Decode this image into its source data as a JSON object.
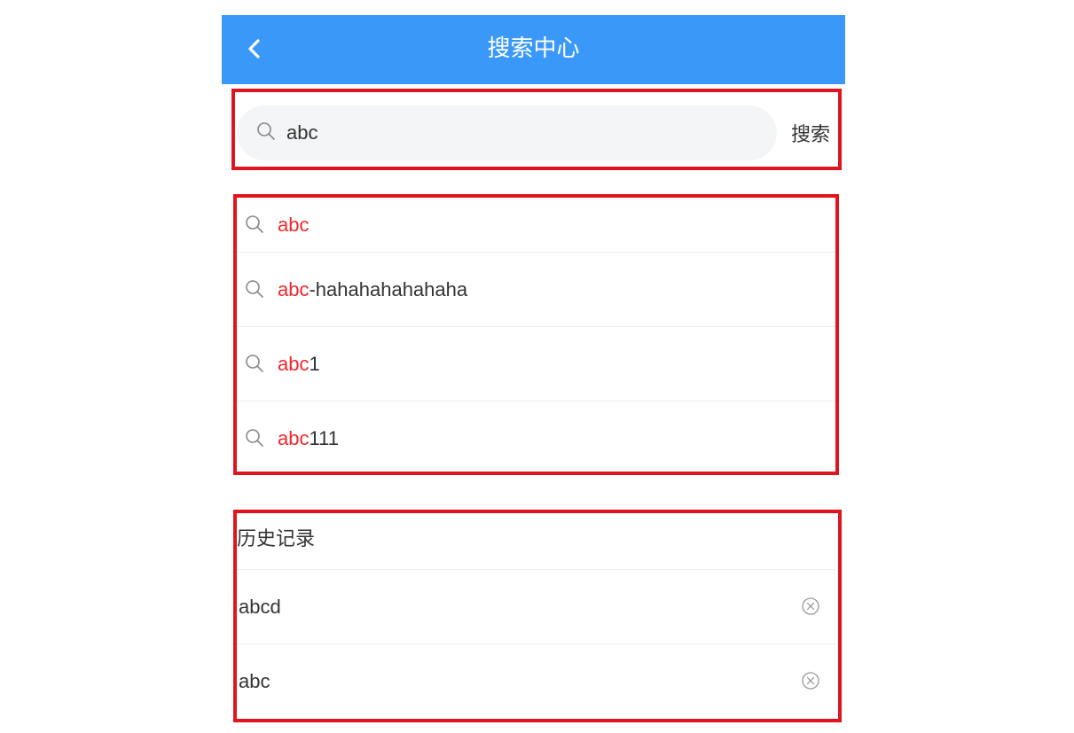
{
  "header": {
    "title": "搜索中心",
    "back_icon": "chevron-left-icon",
    "background": "#3a99f8"
  },
  "search": {
    "value": "abc",
    "placeholder": "",
    "button_label": "搜索",
    "icon": "search-icon"
  },
  "suggestions": [
    {
      "highlight": "abc",
      "rest": ""
    },
    {
      "highlight": "abc",
      "rest": "-hahahahahahaha"
    },
    {
      "highlight": "abc",
      "rest": "1"
    },
    {
      "highlight": "abc",
      "rest": "111"
    }
  ],
  "history": {
    "title": "历史记录",
    "items": [
      {
        "text": "abcd",
        "delete_icon": "close-circle-icon"
      },
      {
        "text": "abc",
        "delete_icon": "close-circle-icon"
      }
    ]
  },
  "colors": {
    "highlight": "#f2272c",
    "annotation_border": "#e0141e"
  }
}
